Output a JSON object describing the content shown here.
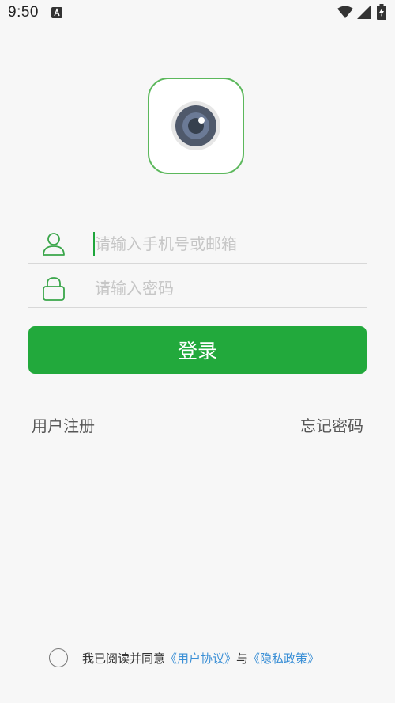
{
  "status_bar": {
    "time": "9:50",
    "icons": [
      "notification-a-icon",
      "wifi-icon",
      "signal-icon",
      "battery-charging-icon"
    ]
  },
  "logo": {
    "icon": "camera-lens-icon",
    "accent_color": "#5cb85c"
  },
  "account": {
    "icon": "user-icon",
    "placeholder": "请输入手机号或邮箱",
    "value": ""
  },
  "password": {
    "icon": "lock-icon",
    "placeholder": "请输入密码",
    "value": ""
  },
  "login_button": {
    "label": "登录",
    "color": "#22a93c"
  },
  "links": {
    "register": "用户注册",
    "forgot": "忘记密码"
  },
  "agreement": {
    "text_prefix": "我已阅读并同意",
    "user_agreement": "《用户协议》",
    "conjunction": "与",
    "privacy_policy": "《隐私政策》",
    "checked": false
  }
}
